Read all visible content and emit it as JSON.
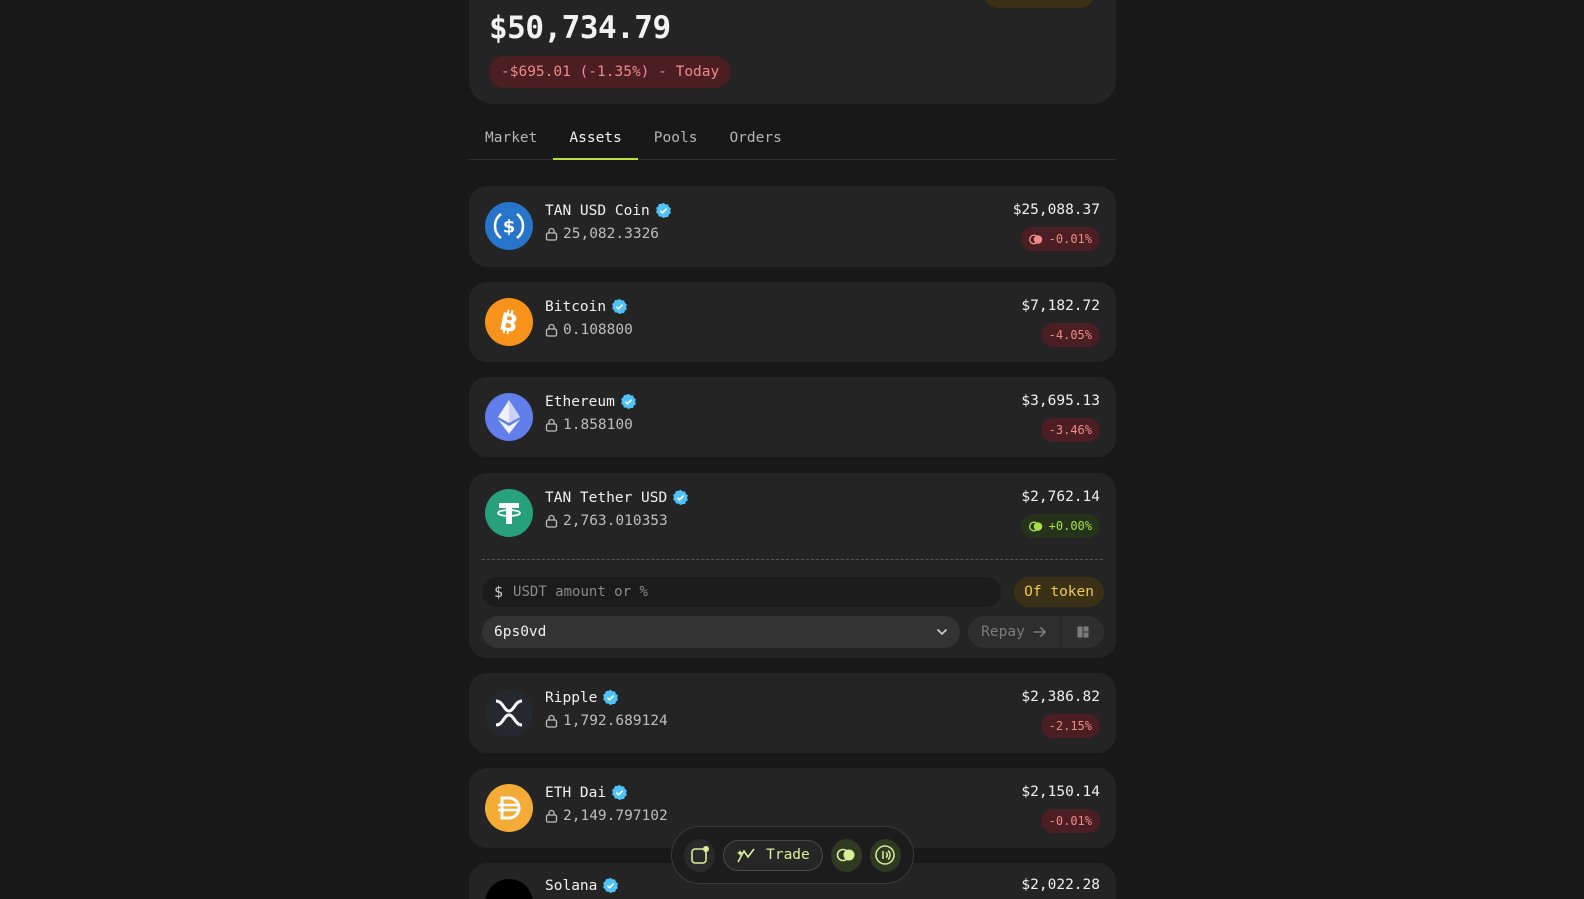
{
  "portfolio": {
    "total_balance": "$50,734.79",
    "change_text": "-$695.01 (-1.35%) - Today"
  },
  "tabs": [
    {
      "label": "Market"
    },
    {
      "label": "Assets",
      "active": true
    },
    {
      "label": "Pools"
    },
    {
      "label": "Orders"
    }
  ],
  "assets": [
    {
      "name": "TAN USD Coin",
      "amount": "25,082.3326",
      "value": "$25,088.37",
      "change": "-0.01%",
      "direction": "negative",
      "icon": "usdc-icon",
      "color": "#2775ca"
    },
    {
      "name": "Bitcoin",
      "amount": "0.108800",
      "value": "$7,182.72",
      "change": "-4.05%",
      "direction": "negative",
      "icon": "bitcoin-icon",
      "color": "#f7931a"
    },
    {
      "name": "Ethereum",
      "amount": "1.858100",
      "value": "$3,695.13",
      "change": "-3.46%",
      "direction": "negative",
      "icon": "ethereum-icon",
      "color": "#627eea"
    },
    {
      "name": "TAN Tether USD",
      "amount": "2,763.010353",
      "value": "$2,762.14",
      "change": "+0.00%",
      "direction": "positive",
      "icon": "tether-icon",
      "color": "#26a17b"
    },
    {
      "name": "Ripple",
      "amount": "1,792.689124",
      "value": "$2,386.82",
      "change": "-2.15%",
      "direction": "negative",
      "icon": "ripple-icon",
      "color": "#23292f"
    },
    {
      "name": "ETH Dai",
      "amount": "2,149.797102",
      "value": "$2,150.14",
      "change": "-0.01%",
      "direction": "negative",
      "icon": "dai-icon",
      "color": "#f5ac37"
    },
    {
      "name": "Solana",
      "value": "$2,022.28",
      "icon": "solana-icon",
      "color": "#000000"
    }
  ],
  "expanded": {
    "currency_symbol": "$",
    "amount_placeholder": "USDT amount or %",
    "of_token_label": "Of token",
    "selected_account": "6ps0vd",
    "repay_label": "Repay"
  },
  "dock": {
    "trade_label": "Trade"
  },
  "colors": {
    "accent": "#b8e23a",
    "negative": "#f08a8a",
    "positive": "#a6e04a",
    "verified": "#4fc3f7"
  }
}
